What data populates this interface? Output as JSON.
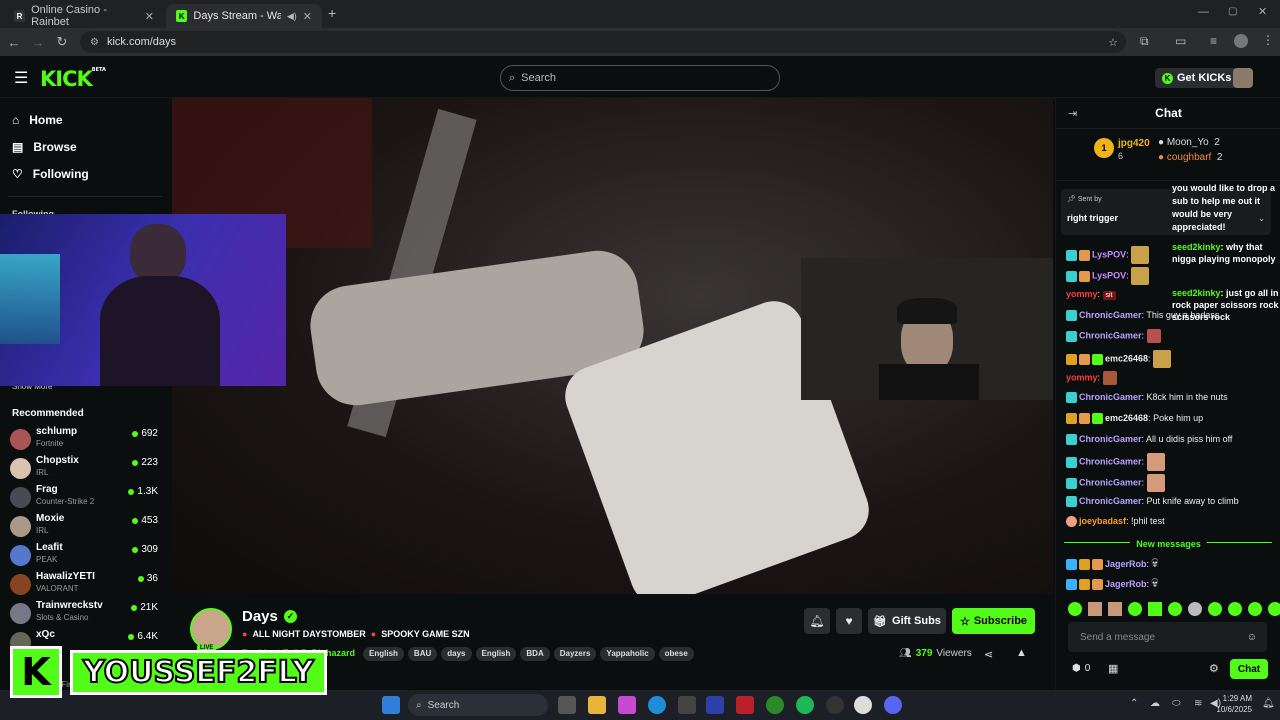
{
  "browser": {
    "tabs": [
      {
        "title": "Online Casino - Rainbet",
        "active": false
      },
      {
        "title": "Days Stream - Watch Live o",
        "active": true
      }
    ],
    "new_tab": "+",
    "url": "kick.com/days"
  },
  "header": {
    "logo": "KICK",
    "logo_tag": "BETA",
    "search_placeholder": "Search",
    "get_kicks": "Get KICKs"
  },
  "sidebar": {
    "nav": [
      {
        "label": "Home",
        "icon": "home-icon"
      },
      {
        "label": "Browse",
        "icon": "browse-icon"
      },
      {
        "label": "Following",
        "icon": "heart-icon"
      }
    ],
    "following_header": "Following",
    "show_more": "Show More",
    "recommended_title": "Recommended",
    "recommended": [
      {
        "name": "schlump",
        "category": "Fortnite",
        "viewers": "692",
        "color": "#a55"
      },
      {
        "name": "Chopstix",
        "category": "IRL",
        "viewers": "223",
        "color": "#d9c2b0"
      },
      {
        "name": "Frag",
        "category": "Counter-Strike 2",
        "viewers": "1.3K",
        "color": "#4a4a55"
      },
      {
        "name": "Moxie",
        "category": "IRL",
        "viewers": "453",
        "color": "#a98"
      },
      {
        "name": "Leafit",
        "category": "PEAK",
        "viewers": "309",
        "color": "#57c"
      },
      {
        "name": "HawalizYETI",
        "category": "VALORANT",
        "viewers": "36",
        "color": "#842"
      },
      {
        "name": "Trainwreckstv",
        "category": "Slots & Casino",
        "viewers": "21K",
        "color": "#778"
      },
      {
        "name": "xQc",
        "category": "",
        "viewers": "6.4K",
        "color": "#665"
      }
    ],
    "bottom_item": "Avatar: Fire and..."
  },
  "overlay": {
    "logo_letter": "K",
    "name": "YOUSSEF2FLY"
  },
  "channel": {
    "name": "Days",
    "title": "ALL NIGHT DAYSTOMBER",
    "title_2": "SPOOKY GAME SZN",
    "category": "Resident Evil 7: Biohazard",
    "tags": [
      "English",
      "BAU",
      "days",
      "English",
      "BDA",
      "Dayzers",
      "Yappaholic",
      "obese"
    ],
    "gift_subs": "Gift Subs",
    "subscribe": "Subscribe",
    "viewers": "379",
    "viewers_label": "Viewers",
    "live_badge": "LIVE"
  },
  "chat": {
    "title": "Chat",
    "leaderboard": [
      {
        "rank": "1",
        "name": "jpg420",
        "count": "6"
      },
      {
        "name": "Moon_Yo",
        "count": "2"
      },
      {
        "name": "coughbarf",
        "count": "2"
      }
    ],
    "pinned": {
      "sent_by": "Sent by",
      "text": "right trigger"
    },
    "gift_text": "you would like to drop a sub to help me out it would be very appreciated!",
    "messages": [
      {
        "user": "LysPOV",
        "color": "#c68cff",
        "text": ""
      },
      {
        "user": "LysPOV",
        "color": "#c68cff",
        "text": ""
      },
      {
        "user": "yommy",
        "color": "#ff3b3b",
        "text": ""
      },
      {
        "user": "ChronicGamer",
        "color": "#b9a2ff",
        "text": "This guy a badass"
      },
      {
        "user": "ChronicGamer",
        "color": "#b9a2ff",
        "text": ""
      },
      {
        "user": "emc26468",
        "color": "#eee",
        "text": ""
      },
      {
        "user": "yommy",
        "color": "#ff3b3b",
        "text": ""
      },
      {
        "user": "ChronicGamer",
        "color": "#b9a2ff",
        "text": "K8ck him in the nuts"
      },
      {
        "user": "emc26468",
        "color": "#eee",
        "text": "Poke him up"
      },
      {
        "user": "ChronicGamer",
        "color": "#b9a2ff",
        "text": "All u didis piss him off"
      },
      {
        "user": "ChronicGamer",
        "color": "#b9a2ff",
        "text": ""
      },
      {
        "user": "ChronicGamer",
        "color": "#b9a2ff",
        "text": ""
      },
      {
        "user": "ChronicGamer",
        "color": "#b9a2ff",
        "text": "Put knife away to climb"
      },
      {
        "user": "joeybadasf",
        "color": "#ff9f1a",
        "text": "!phil test"
      }
    ],
    "side_messages": [
      {
        "user": "seed2kinky",
        "text": "why that nigga playing monopoly"
      },
      {
        "user": "seed2kinky",
        "text": "just go all in rock paper scissors rock scissors rock"
      }
    ],
    "emote_sit": "sit",
    "new_messages": "New messages",
    "after_new": [
      {
        "user": "JagerRob",
        "color": "#b9a2ff"
      },
      {
        "user": "JagerRob",
        "color": "#b9a2ff"
      }
    ],
    "input_placeholder": "Send a message",
    "points": "0",
    "send": "Chat"
  },
  "taskbar": {
    "search": "Search",
    "time": "1:29 AM",
    "date": "10/6/2025"
  }
}
